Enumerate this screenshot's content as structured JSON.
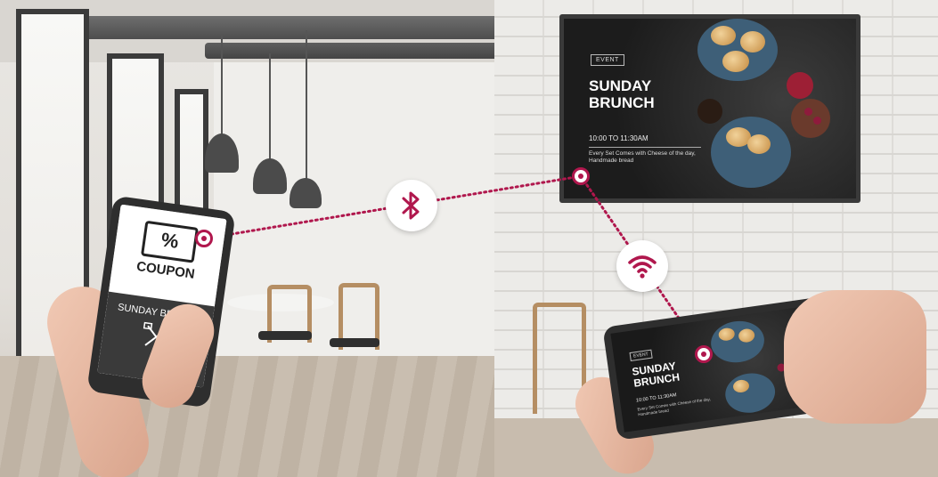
{
  "tv_screen": {
    "badge": "EVENT",
    "title": "SUNDAY BRUNCH",
    "time": "10:00 TO 11:30AM",
    "description": "Every Set Comes with Cheese of the day, Handmade bread"
  },
  "left_phone": {
    "icon_symbol": "%",
    "coupon_label": "COUPON",
    "title": "SUNDAY BRUNCH",
    "utensils_icon": "fork-and-knife-icon"
  },
  "right_phone": {
    "badge": "EVENT",
    "title": "SUNDAY BRUNCH",
    "time": "10:00 TO 11:30AM",
    "description": "Every Set Comes with Cheese of the day, Handmade bread"
  },
  "connections": {
    "bluetooth_icon": "bluetooth-icon",
    "wifi_icon": "wifi-icon",
    "accent_color": "#b0174d"
  }
}
